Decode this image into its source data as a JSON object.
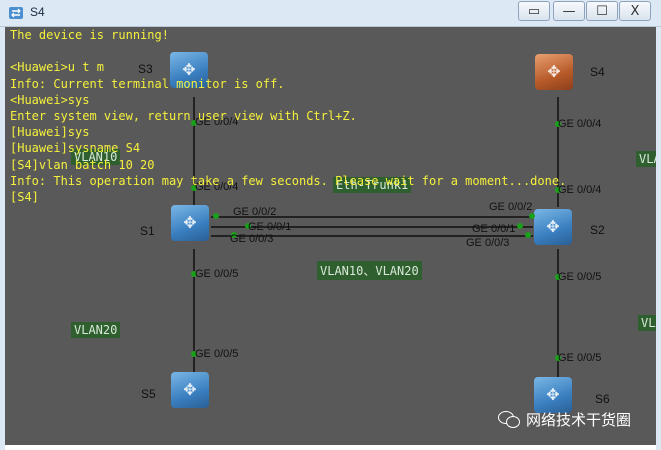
{
  "window": {
    "title": "S4",
    "buttons": {
      "minimize": "—",
      "maximize": "☐",
      "close": "X",
      "extra": "▭"
    }
  },
  "console_lines": [
    "The device is running!",
    "",
    "<Huawei>u t m",
    "Info: Current terminal monitor is off.",
    "<Huawei>sys",
    "Enter system view, return user view with Ctrl+Z.",
    "[Huawei]sys",
    "[Huawei]sysname S4",
    "[S4]vlan batch 10 20",
    "Info: This operation may take a few seconds. Please wait for a moment...done.",
    "[S4]"
  ],
  "topology": {
    "devices": {
      "s3": "S3",
      "s4": "S4",
      "s1": "S1",
      "s2": "S2",
      "s5": "S5",
      "s6": "S6"
    },
    "ports": {
      "s3_down": "GE 0/0/4",
      "s1_up": "GE 0/0/4",
      "s4_down": "GE 0/0/4",
      "s2_up": "GE 0/0/4",
      "s1_p2": "GE 0/0/2",
      "s1_p1": "GE 0/0/1",
      "s1_p3": "GE 0/0/3",
      "s2_p2": "GE 0/0/2",
      "s2_p1": "GE 0/0/1",
      "s2_p3": "GE 0/0/3",
      "s1_down": "GE 0/0/5",
      "s5_up": "GE 0/0/5",
      "s2_down": "GE 0/0/5",
      "s6_up": "GE 0/0/5"
    },
    "vlan_labels": {
      "eth_trunk": "Eth-Trunk1",
      "trunk_vlans": "VLAN10、VLAN20",
      "left_vlan20": "VLAN20",
      "top_left_vlan": "VLAN10",
      "right_top": "VLA",
      "right_mid": "VLA"
    }
  },
  "watermark": "网络技术干货圈",
  "colors": {
    "terminal_bg": "#595959",
    "console_text": "#f5f03c",
    "titlebar": "#dce8f4",
    "vlan_label_bg": "#2f5f2f"
  },
  "icons": {
    "title_icon": "switch-app-icon",
    "watermark_icon": "wechat-icon"
  }
}
